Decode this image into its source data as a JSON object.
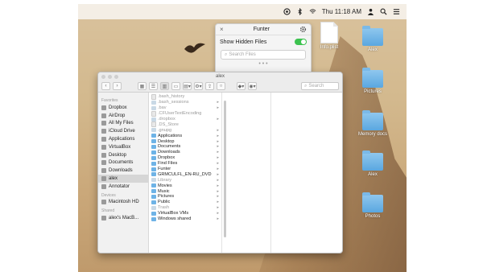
{
  "menubar": {
    "time": "Thu 11:18 AM"
  },
  "popover": {
    "title": "Funter",
    "close_icon": "close-icon",
    "gear_icon": "gear-icon",
    "toggle_label": "Show Hidden Files",
    "toggle_on": true,
    "search_placeholder": "Search Files",
    "more_dots": "• • •"
  },
  "desktop_icons": [
    {
      "label": "Info.plist",
      "kind": "doc"
    },
    {
      "label": "Alex",
      "kind": "folder"
    },
    {
      "label": "Pictures",
      "kind": "folder"
    },
    {
      "label": "Memory docs",
      "kind": "folder"
    },
    {
      "label": "Alex",
      "kind": "folder"
    },
    {
      "label": "Photos",
      "kind": "folder"
    }
  ],
  "finder": {
    "title": "alex",
    "search_placeholder": "Search",
    "sidebar": {
      "favorites_head": "Favorites",
      "favorites": [
        "Dropbox",
        "AirDrop",
        "All My Files",
        "iCloud Drive",
        "Applications",
        "VirtualBox",
        "Desktop",
        "Documents",
        "Downloads",
        "alex",
        "Annotator"
      ],
      "devices_head": "Devices",
      "devices": [
        "Macintosh HD"
      ],
      "shared_head": "Shared",
      "shared": [
        "alex's MacB..."
      ]
    },
    "files": [
      {
        "name": ".bash_history",
        "hidden": true,
        "folder": false,
        "arrow": false
      },
      {
        "name": ".bash_sessions",
        "hidden": true,
        "folder": true,
        "arrow": true
      },
      {
        "name": ".bav",
        "hidden": true,
        "folder": true,
        "arrow": true
      },
      {
        "name": ".CFUserTextEncoding",
        "hidden": true,
        "folder": false,
        "arrow": false
      },
      {
        "name": ".dropbox",
        "hidden": true,
        "folder": true,
        "arrow": true
      },
      {
        "name": ".DS_Store",
        "hidden": true,
        "folder": false,
        "arrow": false
      },
      {
        "name": ".gnupg",
        "hidden": true,
        "folder": true,
        "arrow": true
      },
      {
        "name": "Applications",
        "hidden": false,
        "folder": true,
        "arrow": true
      },
      {
        "name": "Desktop",
        "hidden": false,
        "folder": true,
        "arrow": true
      },
      {
        "name": "Documents",
        "hidden": false,
        "folder": true,
        "arrow": true
      },
      {
        "name": "Downloads",
        "hidden": false,
        "folder": true,
        "arrow": true
      },
      {
        "name": "Dropbox",
        "hidden": false,
        "folder": true,
        "arrow": true
      },
      {
        "name": "Find Files",
        "hidden": false,
        "folder": true,
        "arrow": true
      },
      {
        "name": "Funter",
        "hidden": false,
        "folder": true,
        "arrow": true
      },
      {
        "name": "GRMCULFL_EN-RU_DVD",
        "hidden": false,
        "folder": true,
        "arrow": true
      },
      {
        "name": "Library",
        "hidden": true,
        "folder": true,
        "arrow": true
      },
      {
        "name": "Movies",
        "hidden": false,
        "folder": true,
        "arrow": true
      },
      {
        "name": "Music",
        "hidden": false,
        "folder": true,
        "arrow": true
      },
      {
        "name": "Pictures",
        "hidden": false,
        "folder": true,
        "arrow": true
      },
      {
        "name": "Public",
        "hidden": false,
        "folder": true,
        "arrow": true
      },
      {
        "name": "Trash",
        "hidden": true,
        "folder": true,
        "arrow": true
      },
      {
        "name": "VirtualBox VMs",
        "hidden": false,
        "folder": true,
        "arrow": true
      },
      {
        "name": "Windows shared",
        "hidden": false,
        "folder": true,
        "arrow": true
      }
    ]
  },
  "colors": {
    "toggle_on": "#3cc24f",
    "folder": "#5aa7e0"
  }
}
